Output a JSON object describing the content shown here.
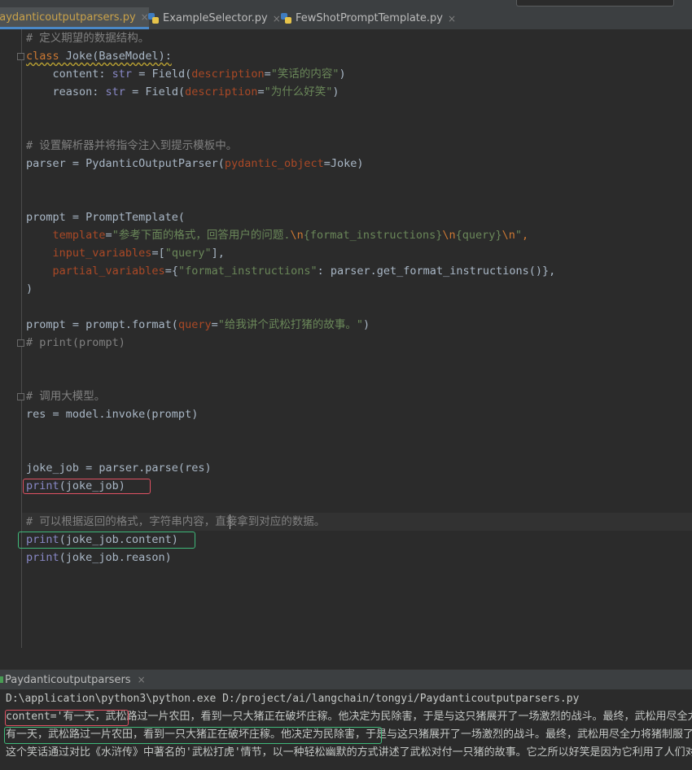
{
  "tabs": [
    {
      "label": "Paydanticoutputparsers.py",
      "active": true
    },
    {
      "label": "ExampleSelector.py",
      "active": false
    },
    {
      "label": "FewShotPromptTemplate.py",
      "active": false
    }
  ],
  "close_glyph": "×",
  "code": {
    "l1": "# 定义期望的数据结构。",
    "l2_kw": "class ",
    "l2_name": "Joke(BaseModel):",
    "l3_a": "    content: ",
    "l3_type": "str",
    "l3_b": " = Field(",
    "l3_param": "description",
    "l3_eq": "=",
    "l3_str": "\"笑话的内容\"",
    "l3_end": ")",
    "l4_a": "    reason: ",
    "l4_type": "str",
    "l4_b": " = Field(",
    "l4_param": "description",
    "l4_eq": "=",
    "l4_str": "\"为什么好笑\"",
    "l4_end": ")",
    "l7": "# 设置解析器并将指令注入到提示模板中。",
    "l8_a": "parser = PydanticOutputParser(",
    "l8_param": "pydantic_object",
    "l8_b": "=Joke)",
    "l11": "prompt = PromptTemplate(",
    "l12_a": "    ",
    "l12_param": "template",
    "l12_eq": "=",
    "l12_s1": "\"参考下面的格式，回答用户的问题.",
    "l12_e1": "\\n",
    "l12_s2": "{format_instructions}",
    "l12_e2": "\\n",
    "l12_s3": "{query}",
    "l12_e3": "\\n",
    "l12_s4": "\"",
    "l12_end": ",",
    "l13_a": "    ",
    "l13_param": "input_variables",
    "l13_eq": "=[",
    "l13_str": "\"query\"",
    "l13_end": "],",
    "l14_a": "    ",
    "l14_param": "partial_variables",
    "l14_eq": "={",
    "l14_str": "\"format_instructions\"",
    "l14_b": ": parser.get_format_instructions()},",
    "l15": ")",
    "l17_a": "prompt = prompt.format(",
    "l17_param": "query",
    "l17_eq": "=",
    "l17_str": "\"给我讲个武松打猪的故事。\"",
    "l17_end": ")",
    "l18": "# print(prompt)",
    "l21": "# 调用大模型。",
    "l22": "res = model.invoke(prompt)",
    "l25": "joke_job = parser.parse(res)",
    "l26_fn": "print",
    "l26_b": "(joke_job)",
    "l28": "# 可以根据返回的格式，字符串内容，直接拿到对应的数据。",
    "l29_fn": "print",
    "l29_b": "(joke_job.content)",
    "l30_fn": "print",
    "l30_b": "(joke_job.reason)"
  },
  "run": {
    "tab_label": "Paydanticoutputparsers",
    "out1": "D:\\application\\python3\\python.exe D:/project/ai/langchain/tongyi/Paydanticoutputparsers.py",
    "out2": "content='有一天，武松路过一片农田，看到一只大猪正在破坏庄稼。他决定为民除害，于是与这只猪展开了一场激烈的战斗。最终，武松用尽全力",
    "out3": "有一天，武松路过一片农田，看到一只大猪正在破坏庄稼。他决定为民除害，于是与这只猪展开了一场激烈的战斗。最终，武松用尽全力将猪制服了",
    "out4": "这个笑话通过对比《水浒传》中著名的'武松打虎'情节，以一种轻松幽默的方式讲述了武松对付一只猪的故事。它之所以好笑是因为它利用了人们对"
  }
}
